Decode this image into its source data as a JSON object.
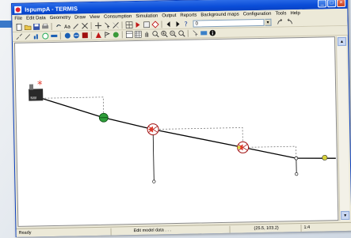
{
  "window": {
    "title": "IspumpA - TERMIS"
  },
  "menu": [
    "File",
    "Edit Data",
    "Geometry",
    "Draw",
    "View",
    "Consumption",
    "Simulation",
    "Output",
    "Reports",
    "Background maps",
    "Configuration",
    "Tools",
    "Help"
  ],
  "toolbar": {
    "field_value": "0"
  },
  "status": {
    "left": "Ready",
    "mode": "Edit model data . . .",
    "coords": "(25.5, 103.2)",
    "scale": "1:4"
  },
  "colors": {
    "titlebar": "#0a4dd8",
    "pipe": "#000000",
    "dashed": "#777777",
    "valve_red": "#e03a2c",
    "pump_green": "#2e9e3a",
    "node_yellow": "#d8d23a"
  },
  "icons": [
    "new-icon",
    "open-icon",
    "save-icon",
    "print-icon",
    "undo-icon",
    "font-icon",
    "cut-icon",
    "move-icon",
    "select-icon",
    "table-icon",
    "play-icon",
    "zoom-icon",
    "nav-left-icon",
    "nav-right-icon",
    "help-icon",
    "zoom-in-icon",
    "zoom-out-icon",
    "info-icon"
  ]
}
